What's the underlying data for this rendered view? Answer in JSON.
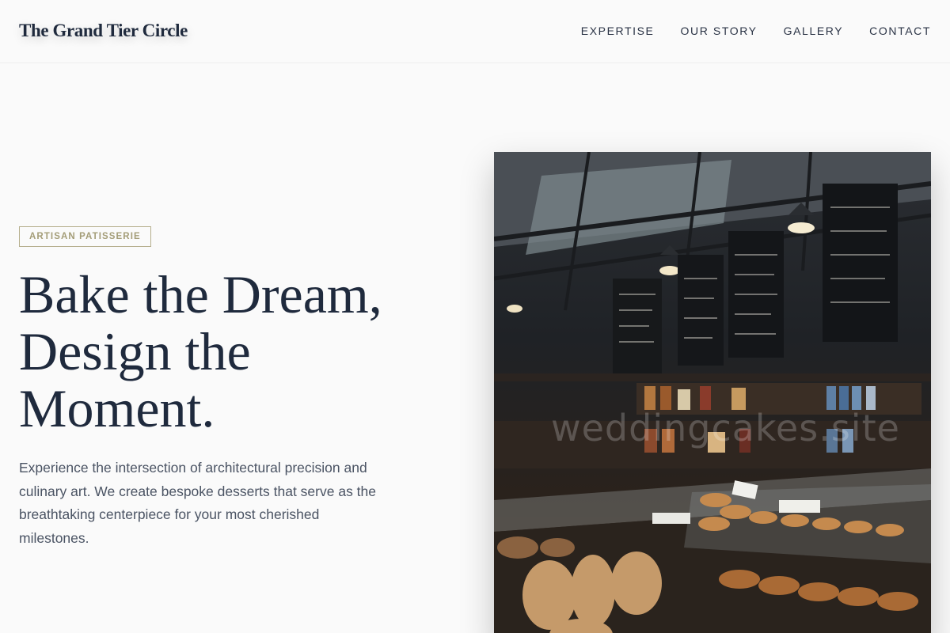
{
  "brand": {
    "name": "The Grand Tier Circle"
  },
  "nav": {
    "items": [
      {
        "label": "EXPERTISE"
      },
      {
        "label": "OUR STORY"
      },
      {
        "label": "GALLERY"
      },
      {
        "label": "CONTACT"
      }
    ]
  },
  "hero": {
    "badge": "ARTISAN PATISSERIE",
    "headline_lines": [
      "Bake the Dream,",
      "Design the",
      "Moment."
    ],
    "description": "Experience the intersection of architectural precision and culinary art. We create bespoke desserts that serve as the breathtaking centerpiece for your most cherished milestones.",
    "image": {
      "watermark": "weddingcakes.site",
      "icon": "bakery-interior-photo"
    }
  },
  "colors": {
    "background": "#fafafa",
    "text_primary": "#1f2a3d",
    "text_secondary": "#4a5363",
    "accent_gold": "#a49d78"
  }
}
